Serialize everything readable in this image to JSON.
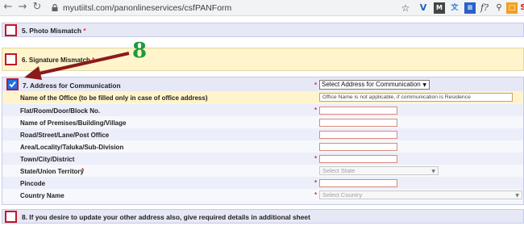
{
  "browser": {
    "url": "myutiitsl.com/panonlineservices/csfPANForm"
  },
  "sections": {
    "photo_mismatch": "5. Photo Mismatch",
    "signature_mismatch": "6. Signature Mismatch",
    "address": "7. Address for Communication",
    "other_address": "8. If you desire to update your other address also, give required details in additional sheet"
  },
  "required_mark": "*",
  "annotation_number": "8",
  "address_select": "Select Address for Communication",
  "fields": [
    {
      "label": "Name of the Office (to be filled only in case of office address)",
      "value": "Office Name is not applicable, if communication is Residence"
    },
    {
      "label": "Flat/Room/Door/Block No."
    },
    {
      "label": "Name of Premises/Building/Village"
    },
    {
      "label": "Road/Street/Lane/Post Office"
    },
    {
      "label": "Area/Locality/Taluka/Sub-Division"
    },
    {
      "label": "Town/City/District"
    },
    {
      "label": "State/Union Territory",
      "placeholder": "Select State"
    },
    {
      "label": "Pincode"
    },
    {
      "label": "Country Name",
      "placeholder": "Select Country"
    }
  ],
  "colors": {
    "section_bg": "#e6e8f6",
    "highlight_bg": "#fff4cc",
    "border_red": "#c4162a",
    "annotation_green": "#1e9a3a",
    "arrow": "#8b1a1a"
  }
}
